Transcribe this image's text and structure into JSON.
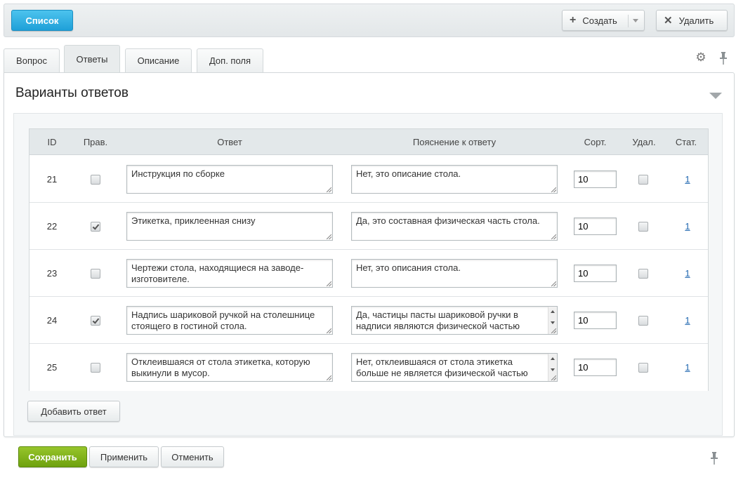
{
  "toolbar": {
    "list_label": "Список",
    "create_label": "Создать",
    "delete_label": "Удалить"
  },
  "tabs": [
    {
      "label": "Вопрос"
    },
    {
      "label": "Ответы"
    },
    {
      "label": "Описание"
    },
    {
      "label": "Доп. поля"
    }
  ],
  "section": {
    "title": "Варианты ответов"
  },
  "table": {
    "headers": {
      "id": "ID",
      "correct": "Прав.",
      "answer": "Ответ",
      "explanation": "Пояснение к ответу",
      "sort": "Сорт.",
      "delete": "Удал.",
      "stat": "Стат."
    },
    "rows": [
      {
        "id": "21",
        "correct": false,
        "answer": "Инструкция по сборке",
        "explanation": "Нет, это описание стола.",
        "sort": "10",
        "stat": "1"
      },
      {
        "id": "22",
        "correct": true,
        "answer": "Этикетка, приклеенная снизу",
        "explanation": "Да, это составная физическая часть стола.",
        "sort": "10",
        "stat": "1"
      },
      {
        "id": "23",
        "correct": false,
        "answer": "Чертежи стола, находящиеся на заводе-изготовителе.",
        "explanation": "Нет, это описания стола.",
        "sort": "10",
        "stat": "1"
      },
      {
        "id": "24",
        "correct": true,
        "answer": "Надпись шариковой ручкой на столешнице стоящего в гостиной стола.",
        "explanation": "Да, частицы пасты шариковой ручки в надписи являются физической частью",
        "sort": "10",
        "stat": "1"
      },
      {
        "id": "25",
        "correct": false,
        "answer": "Отклеившаяся от стола этикетка, которую выкинули в мусор.",
        "explanation": "Нет, отклеившаяся от стола этикетка больше не является физической частью",
        "sort": "10",
        "stat": "1"
      }
    ]
  },
  "add_answer_label": "Добавить ответ",
  "footer": {
    "save_label": "Сохранить",
    "apply_label": "Применить",
    "cancel_label": "Отменить"
  },
  "colors": {
    "list_button": "#1fa0d8",
    "save_button": "#7aab17",
    "link": "#2067b0"
  },
  "icons": {
    "create": "plus-icon",
    "delete": "close-icon",
    "settings": "gear-icon",
    "pin": "pin-icon",
    "collapse": "triangle-down-icon"
  }
}
